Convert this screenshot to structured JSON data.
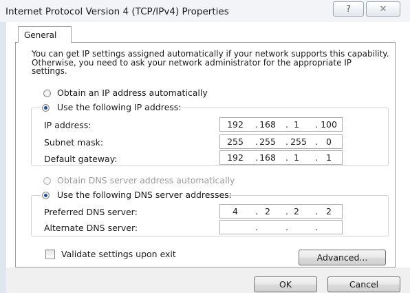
{
  "window": {
    "title": "Internet Protocol Version 4 (TCP/IPv4) Properties",
    "help_glyph": "?",
    "close_glyph": "✕"
  },
  "tabs": [
    {
      "label": "General"
    }
  ],
  "intro_text": "You can get IP settings assigned automatically if your network supports this capability. Otherwise, you need to ask your network administrator for the appropriate IP settings.",
  "ip_section": {
    "auto_label": "Obtain an IP address automatically",
    "manual_label": "Use the following IP address:",
    "selected": "manual",
    "fields": [
      {
        "label": "IP address:",
        "octets": [
          "192",
          "168",
          "1",
          "100"
        ]
      },
      {
        "label": "Subnet mask:",
        "octets": [
          "255",
          "255",
          "255",
          "0"
        ]
      },
      {
        "label": "Default gateway:",
        "octets": [
          "192",
          "168",
          "1",
          "1"
        ]
      }
    ]
  },
  "dns_section": {
    "auto_label": "Obtain DNS server address automatically",
    "manual_label": "Use the following DNS server addresses:",
    "selected": "manual",
    "fields": [
      {
        "label": "Preferred DNS server:",
        "octets": [
          "4",
          "2",
          "2",
          "2"
        ]
      },
      {
        "label": "Alternate DNS server:",
        "octets": [
          "",
          "",
          "",
          ""
        ]
      }
    ]
  },
  "validate": {
    "label": "Validate settings upon exit",
    "checked": false
  },
  "buttons": {
    "advanced": "Advanced...",
    "ok": "OK",
    "cancel": "Cancel"
  },
  "colors": {
    "radio_dot": "#1f4f9c",
    "disabled_text": "#9a9a9a"
  }
}
